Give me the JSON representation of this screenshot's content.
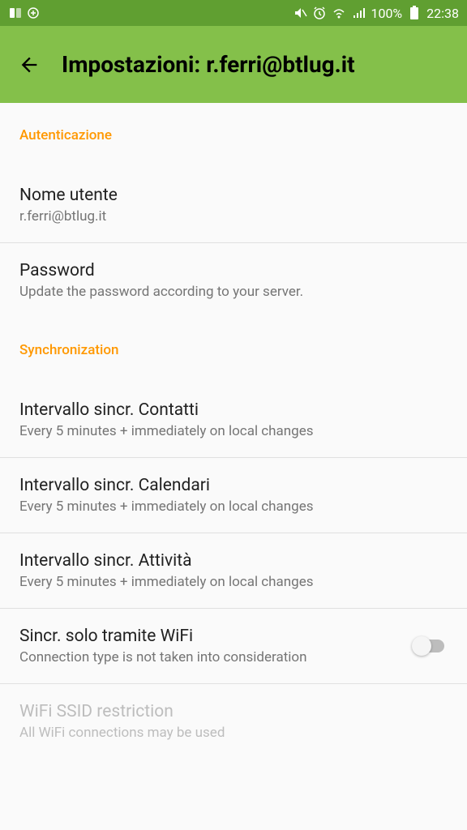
{
  "status_bar": {
    "battery_pct": "100%",
    "time": "22:38"
  },
  "app_bar": {
    "title": "Impostazioni: r.ferri@btlug.it"
  },
  "sections": {
    "auth": {
      "header": "Autenticazione",
      "username": {
        "title": "Nome utente",
        "value": "r.ferri@btlug.it"
      },
      "password": {
        "title": "Password",
        "subtitle": "Update the password according to your server."
      }
    },
    "sync": {
      "header": "Synchronization",
      "contacts": {
        "title": "Intervallo sincr. Contatti",
        "subtitle": "Every 5 minutes + immediately on local changes"
      },
      "calendars": {
        "title": "Intervallo sincr. Calendari",
        "subtitle": "Every 5 minutes + immediately on local changes"
      },
      "tasks": {
        "title": "Intervallo sincr. Attività",
        "subtitle": "Every 5 minutes + immediately on local changes"
      },
      "wifi_only": {
        "title": "Sincr. solo tramite WiFi",
        "subtitle": "Connection type is not taken into consideration"
      },
      "wifi_ssid": {
        "title": "WiFi SSID restriction",
        "subtitle": "All WiFi connections may be used"
      }
    }
  }
}
